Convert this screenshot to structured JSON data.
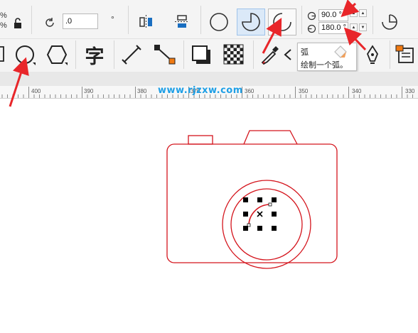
{
  "toolbar_top": {
    "percent_labels": [
      "%",
      "%"
    ],
    "rotation_value": ".0",
    "degree_symbol": "°",
    "start_angle": "90.0 °",
    "end_angle": "180.0 °"
  },
  "ruler": {
    "ticks": [
      "400",
      "390",
      "380",
      "370",
      "360",
      "350",
      "340",
      "330"
    ]
  },
  "watermark": "www.rjzxw.com",
  "tooltip": {
    "title": "弧",
    "description": "绘制一个弧。"
  },
  "tools": {
    "text_tool_glyph": "字"
  },
  "colors": {
    "accent_red": "#e8262a",
    "drawing_red": "#d4141c",
    "selected_bg": "#dbe9f8"
  }
}
